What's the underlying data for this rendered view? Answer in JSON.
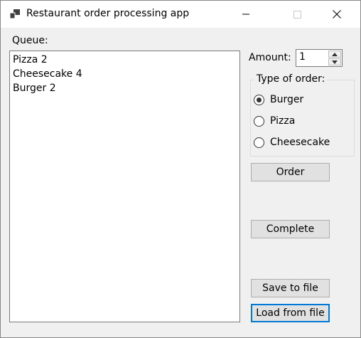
{
  "window": {
    "title": "Restaurant order processing app",
    "app_icon": "windows-form-icon",
    "controls": {
      "minimize": "minimize-icon",
      "maximize": "maximize-icon",
      "close": "close-icon"
    }
  },
  "queue": {
    "label": "Queue:",
    "items": [
      "Pizza 2",
      "Cheesecake 4",
      "Burger 2"
    ]
  },
  "amount": {
    "label": "Amount:",
    "value": "1"
  },
  "order_type": {
    "caption": "Type of order:",
    "options": [
      {
        "label": "Burger",
        "checked": true
      },
      {
        "label": "Pizza",
        "checked": false
      },
      {
        "label": "Cheesecake",
        "checked": false
      }
    ]
  },
  "buttons": {
    "order": "Order",
    "complete": "Complete",
    "save": "Save to file",
    "load": "Load from file"
  },
  "colors": {
    "window_bg": "#f0f0f0",
    "focus_border": "#0078d7",
    "button_bg": "#e1e1e1"
  }
}
